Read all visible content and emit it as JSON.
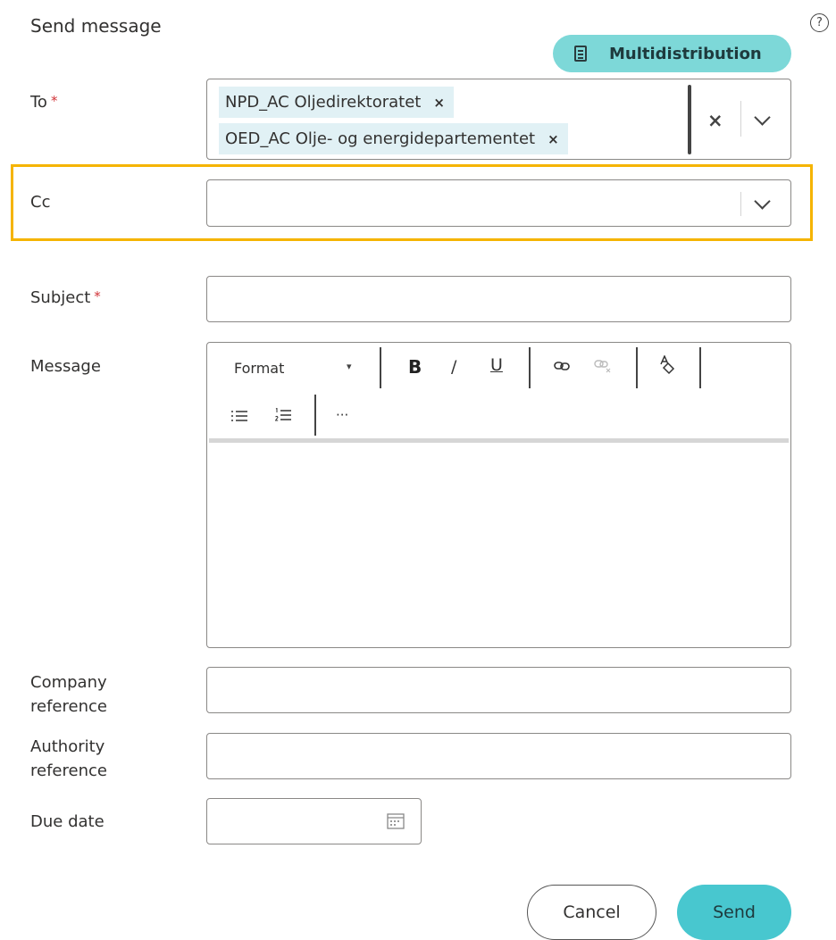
{
  "header": {
    "title": "Send message",
    "help_glyph": "?"
  },
  "multidistribution": {
    "label": "Multidistribution",
    "icon": "document-list-icon"
  },
  "to": {
    "label": "To",
    "required_mark": "*",
    "recipients": [
      {
        "name": "NPD_AC Oljedirektoratet",
        "remove": "×"
      },
      {
        "name": "OED_AC Olje- og energidepartementet",
        "remove": "×"
      }
    ],
    "clear_glyph": "×"
  },
  "cc": {
    "label": "Cc",
    "value": ""
  },
  "subject": {
    "label": "Subject",
    "required_mark": "*",
    "value": ""
  },
  "message": {
    "label": "Message",
    "toolbar": {
      "format_label": "Format",
      "format_caret": "▾",
      "bold": "B",
      "italic": "/",
      "underline": "U",
      "more": "···"
    },
    "body": ""
  },
  "company_reference": {
    "label_line1": "Company",
    "label_line2": "reference",
    "value": ""
  },
  "authority_reference": {
    "label_line1": "Authority",
    "label_line2": "reference",
    "value": ""
  },
  "due_date": {
    "label": "Due date",
    "value": ""
  },
  "actions": {
    "cancel": "Cancel",
    "send": "Send"
  },
  "colors": {
    "accent": "#48c7cf",
    "multi_bg": "#7dd8d8",
    "highlight": "#f5b400",
    "chip_bg": "#e1f1f5",
    "required": "#d13438"
  }
}
